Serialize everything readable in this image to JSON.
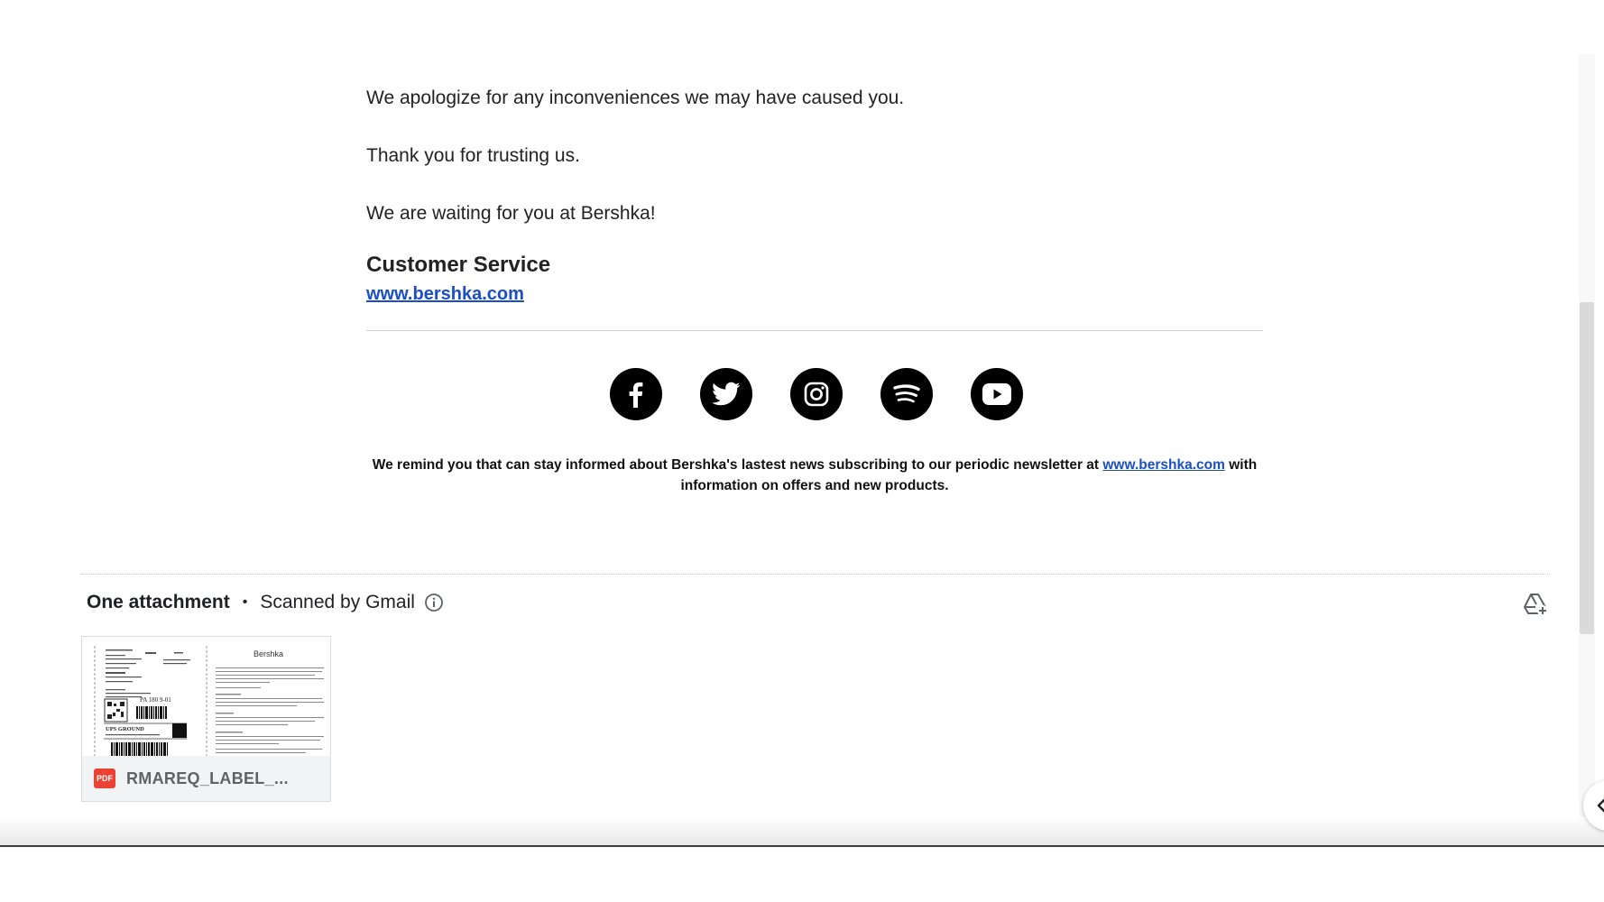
{
  "message": {
    "paragraphs": [
      "We apologize for any inconveniences we may have caused you.",
      "Thank you for trusting us.",
      "We are waiting for you at Bershka!"
    ],
    "signature_title": "Customer Service",
    "signature_link": "www.bershka.com",
    "social_icons": [
      "facebook-icon",
      "twitter-icon",
      "instagram-icon",
      "spotify-icon",
      "youtube-icon"
    ],
    "newsletter": {
      "text_before": "We remind you that can stay informed about Bershka's lastest news subscribing to our periodic newsletter at ",
      "link": "www.bershka.com",
      "text_after": " with information on offers and new products."
    },
    "link_color": "#1a4fc4"
  },
  "attachments": {
    "count_label": "One attachment",
    "separator": "•",
    "scan_label": "Scanned by Gmail",
    "file": {
      "type_label": "PDF",
      "name": "RMAREQ_LABEL_...",
      "preview_brand": "Bershka",
      "preview_service": "UPS GROUND",
      "preview_code": "PA 180 9-01"
    },
    "pdf_color": "#ea4335"
  }
}
